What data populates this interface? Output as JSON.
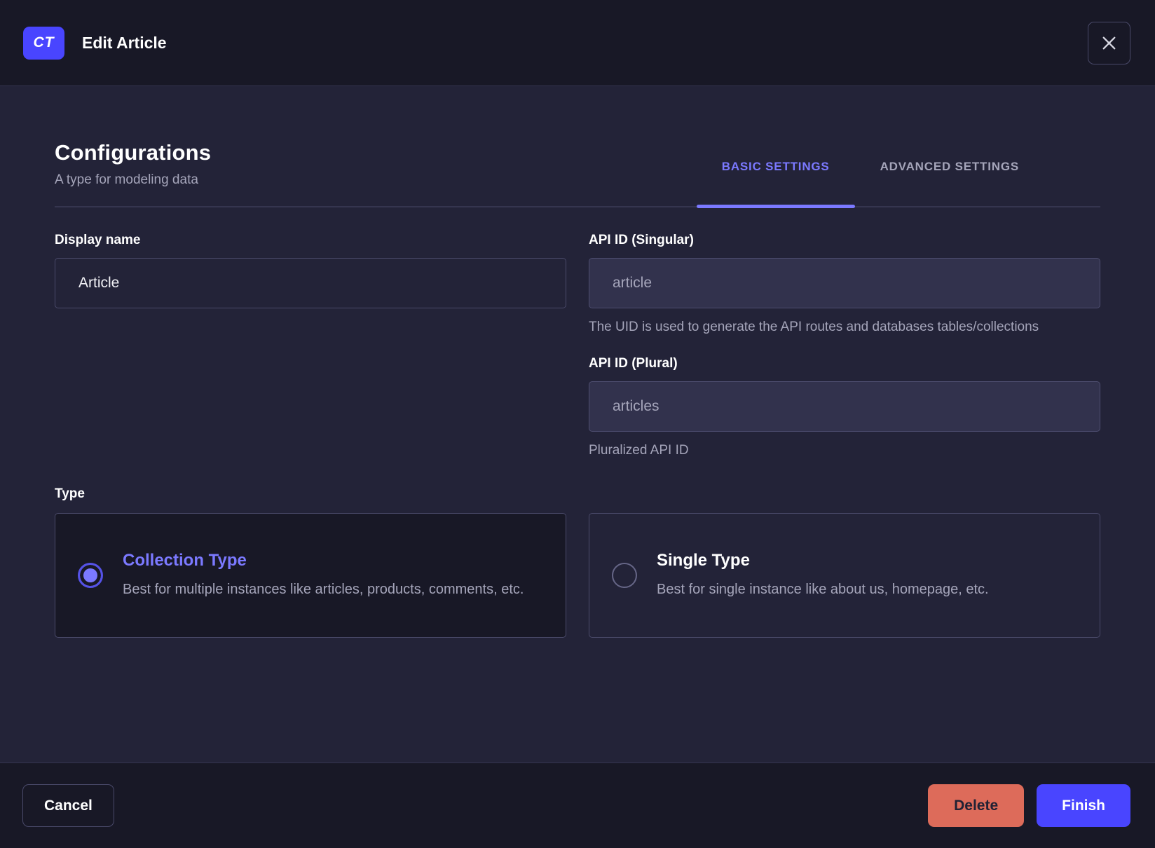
{
  "header": {
    "badge": "CT",
    "title": "Edit Article"
  },
  "section": {
    "title": "Configurations",
    "subtitle": "A type for modeling data"
  },
  "tabs": [
    {
      "label": "BASIC SETTINGS",
      "active": true
    },
    {
      "label": "ADVANCED SETTINGS",
      "active": false
    }
  ],
  "form": {
    "display_name": {
      "label": "Display name",
      "value": "Article"
    },
    "api_id_singular": {
      "label": "API ID (Singular)",
      "placeholder": "article",
      "hint": "The UID is used to generate the API routes and databases tables/collections"
    },
    "api_id_plural": {
      "label": "API ID (Plural)",
      "placeholder": "articles",
      "hint": "Pluralized API ID"
    },
    "type": {
      "label": "Type",
      "options": [
        {
          "title": "Collection Type",
          "description": "Best for multiple instances like articles, products, comments, etc.",
          "selected": true
        },
        {
          "title": "Single Type",
          "description": "Best for single instance like about us, homepage, etc.",
          "selected": false
        }
      ]
    }
  },
  "footer": {
    "cancel_label": "Cancel",
    "delete_label": "Delete",
    "finish_label": "Finish"
  },
  "colors": {
    "accent": "#4945FF",
    "accent_light": "#7B79FF",
    "danger": "#DD6B5A",
    "header_bg": "#181826",
    "body_bg": "#232338"
  }
}
